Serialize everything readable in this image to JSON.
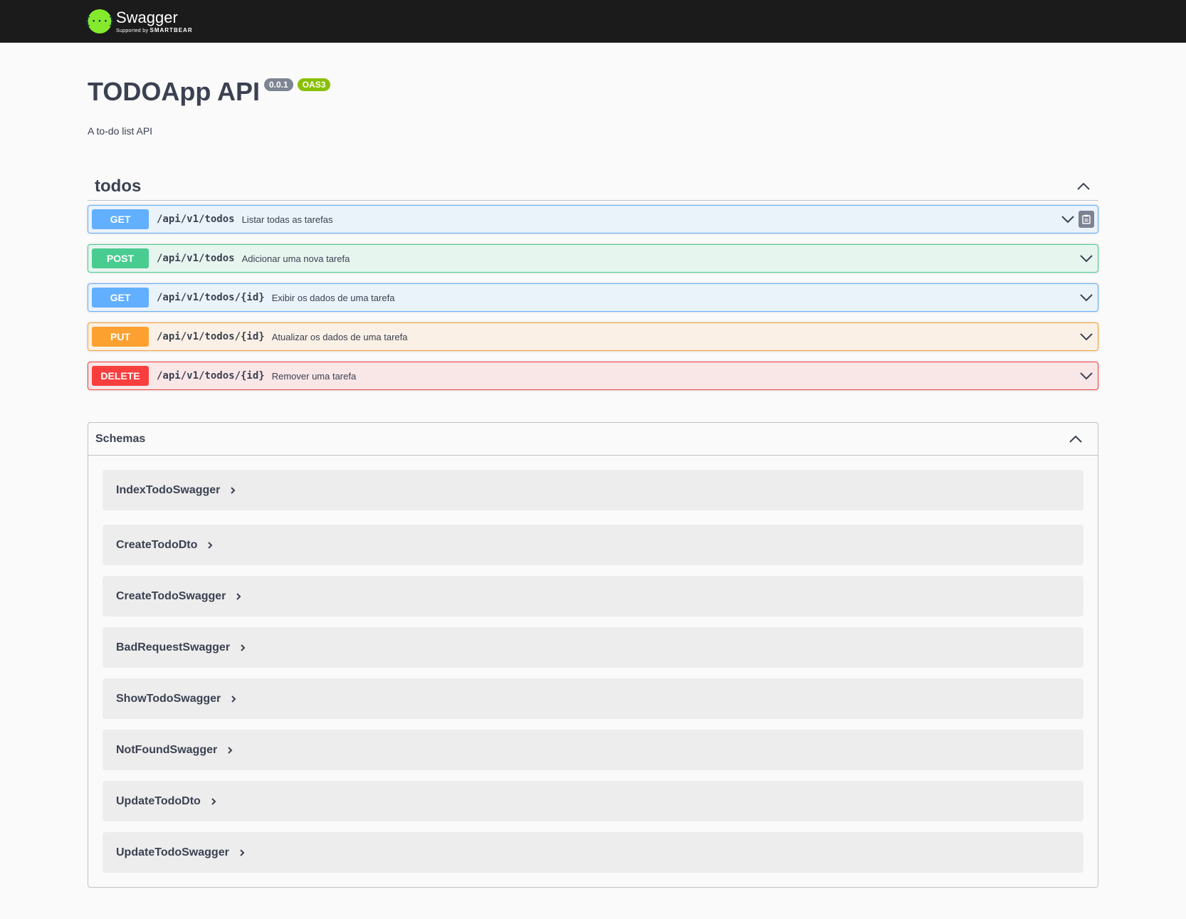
{
  "topbar": {
    "logo_mark": "{···}",
    "logo_name": "Swagger",
    "logo_sub_prefix": "Supported by",
    "logo_sub_brand": "SMARTBEAR"
  },
  "info": {
    "title": "TODOApp API",
    "version": "0.0.1",
    "oas": "OAS3",
    "description": "A to-do list API"
  },
  "tag": {
    "name": "todos",
    "operations": [
      {
        "method": "GET",
        "path": "/api/v1/todos",
        "summary": "Listar todas as tarefas"
      },
      {
        "method": "POST",
        "path": "/api/v1/todos",
        "summary": "Adicionar uma nova tarefa"
      },
      {
        "method": "GET",
        "path": "/api/v1/todos/{id}",
        "summary": "Exibir os dados de uma tarefa"
      },
      {
        "method": "PUT",
        "path": "/api/v1/todos/{id}",
        "summary": "Atualizar os dados de uma tarefa"
      },
      {
        "method": "DELETE",
        "path": "/api/v1/todos/{id}",
        "summary": "Remover uma tarefa"
      }
    ]
  },
  "schemas": {
    "title": "Schemas",
    "items": [
      "IndexTodoSwagger",
      "CreateTodoDto",
      "CreateTodoSwagger",
      "BadRequestSwagger",
      "ShowTodoSwagger",
      "NotFoundSwagger",
      "UpdateTodoDto",
      "UpdateTodoSwagger"
    ]
  },
  "colors": {
    "get": "#61affe",
    "post": "#49cc90",
    "put": "#fca130",
    "delete": "#f93e3e",
    "topbar": "#1b1b1b",
    "logo": "#85ea2d"
  },
  "icons": {
    "collapse": "chevron-up-icon",
    "expand": "chevron-down-icon",
    "copy": "clipboard-icon",
    "model_expand": "chevron-right-icon"
  }
}
